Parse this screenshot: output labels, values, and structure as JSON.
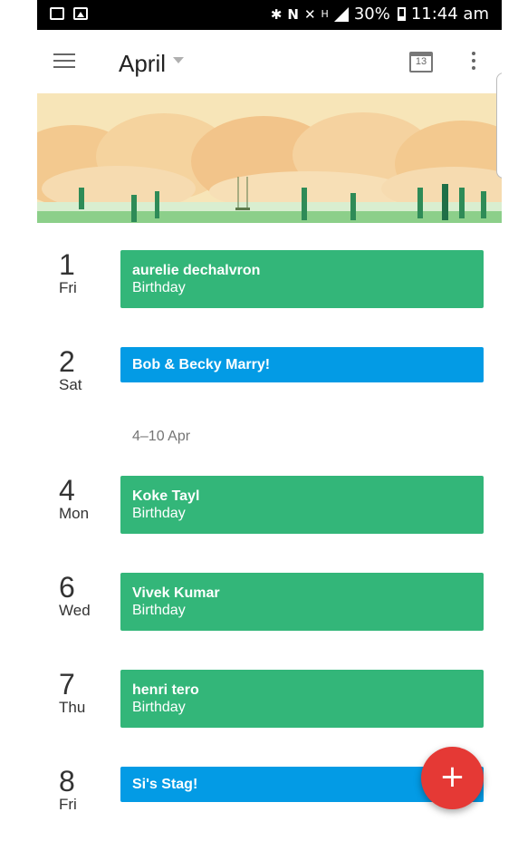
{
  "status_bar": {
    "battery_percent": "30%",
    "time": "11:44 am",
    "network_letter": "H"
  },
  "toolbar": {
    "title": "April",
    "today_date": "13"
  },
  "agenda": [
    {
      "day": "1",
      "weekday": "Fri",
      "events": [
        {
          "title": "aurelie dechalvron",
          "subtitle": "Birthday",
          "color": "#33b679"
        }
      ]
    },
    {
      "day": "2",
      "weekday": "Sat",
      "events": [
        {
          "title": "Bob & Becky Marry!",
          "subtitle": "",
          "color": "#039be5"
        }
      ]
    },
    {
      "week_label": "4–10 Apr"
    },
    {
      "day": "4",
      "weekday": "Mon",
      "events": [
        {
          "title": "Koke Tayl",
          "subtitle": "Birthday",
          "color": "#33b679"
        }
      ]
    },
    {
      "day": "6",
      "weekday": "Wed",
      "events": [
        {
          "title": "Vivek Kumar",
          "subtitle": "Birthday",
          "color": "#33b679"
        }
      ]
    },
    {
      "day": "7",
      "weekday": "Thu",
      "events": [
        {
          "title": "henri tero",
          "subtitle": "Birthday",
          "color": "#33b679"
        }
      ]
    },
    {
      "day": "8",
      "weekday": "Fri",
      "events": [
        {
          "title": "Si's Stag!",
          "subtitle": "",
          "color": "#039be5"
        }
      ]
    }
  ],
  "fab": {
    "label": "+"
  }
}
